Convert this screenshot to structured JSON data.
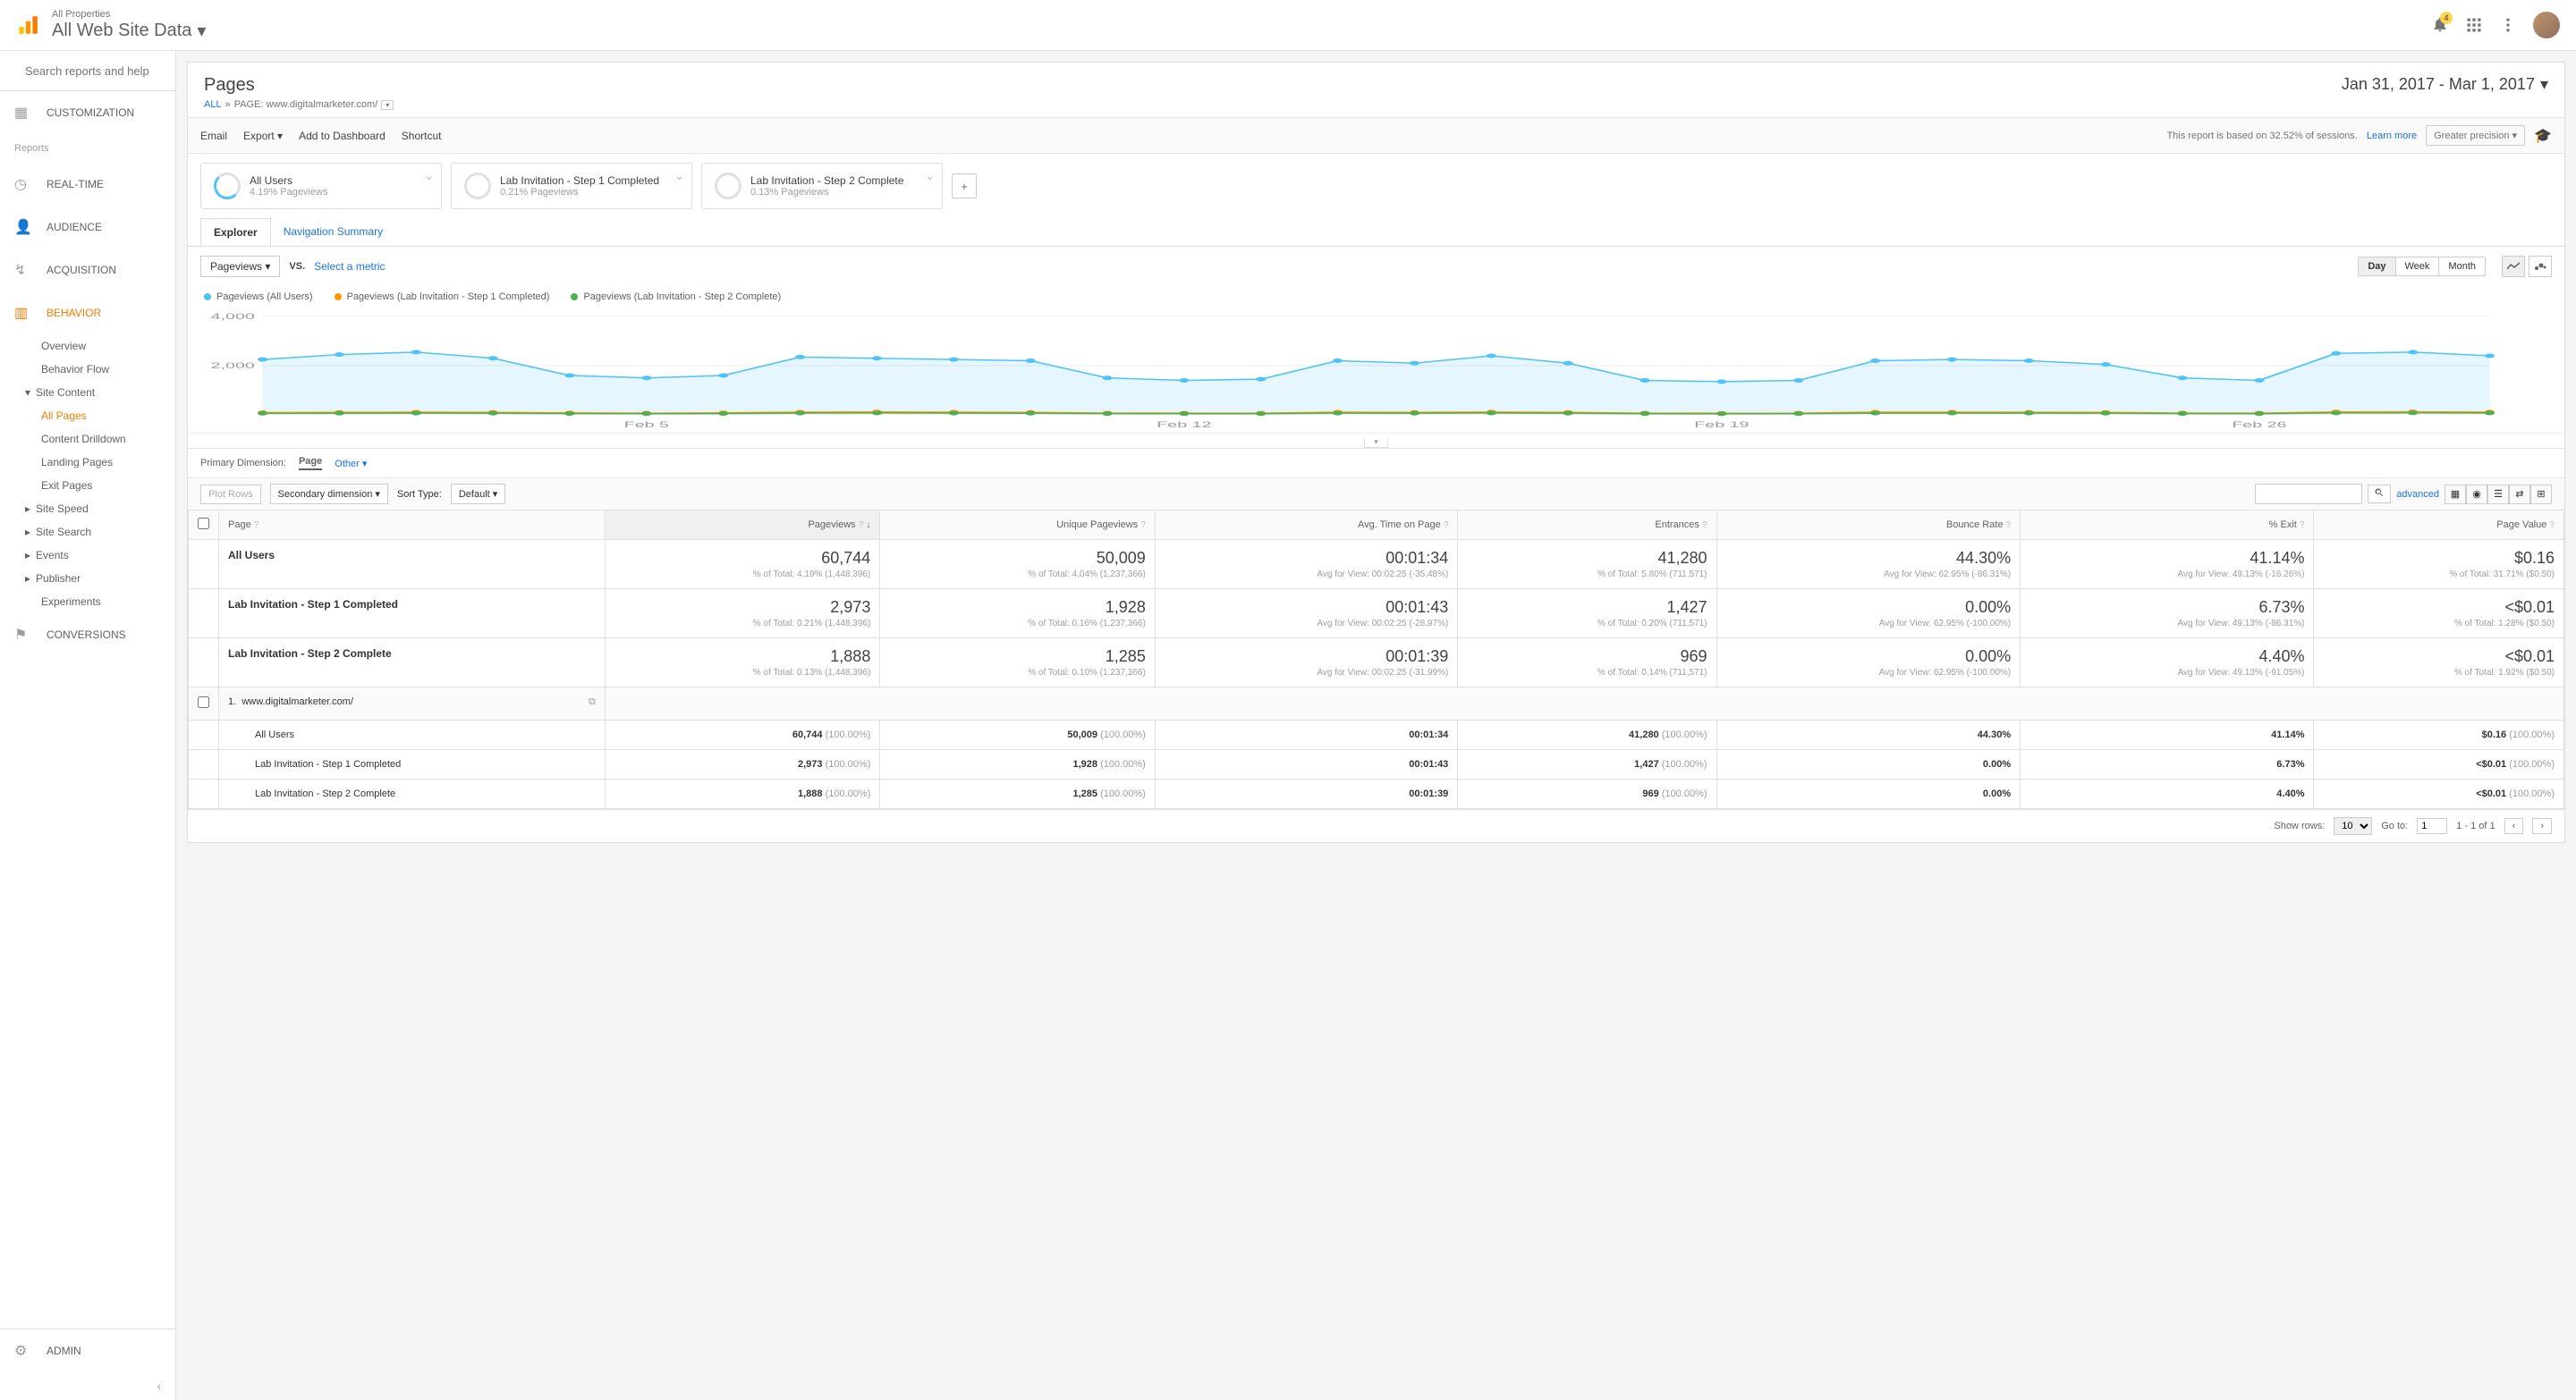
{
  "header": {
    "subtitle": "All Properties",
    "title": "All Web Site Data",
    "notif_count": "4"
  },
  "sidebar": {
    "search_placeholder": "Search reports and help",
    "customization": "CUSTOMIZATION",
    "reports_label": "Reports",
    "realtime": "REAL-TIME",
    "audience": "AUDIENCE",
    "acquisition": "ACQUISITION",
    "behavior": "BEHAVIOR",
    "behavior_sub": {
      "overview": "Overview",
      "flow": "Behavior Flow",
      "site_content": "Site Content",
      "all_pages": "All Pages",
      "drilldown": "Content Drilldown",
      "landing": "Landing Pages",
      "exit": "Exit Pages",
      "speed": "Site Speed",
      "search": "Site Search",
      "events": "Events",
      "publisher": "Publisher",
      "experiments": "Experiments"
    },
    "conversions": "CONVERSIONS",
    "admin": "ADMIN"
  },
  "report": {
    "title": "Pages",
    "breadcrumb_all": "ALL",
    "breadcrumb_page": "PAGE: www.digitalmarketer.com/",
    "date_range": "Jan 31, 2017 - Mar 1, 2017",
    "toolbar": {
      "email": "Email",
      "export": "Export",
      "dashboard": "Add to Dashboard",
      "shortcut": "Shortcut",
      "sample_text": "This report is based on 32.52% of sessions.",
      "learn_more": "Learn more",
      "precision": "Greater precision"
    },
    "segments": [
      {
        "name": "All Users",
        "sub": "4.19% Pageviews"
      },
      {
        "name": "Lab Invitation - Step 1 Completed",
        "sub": "0.21% Pageviews"
      },
      {
        "name": "Lab Invitation - Step 2 Complete",
        "sub": "0.13% Pageviews"
      }
    ],
    "tabs": {
      "explorer": "Explorer",
      "nav_summary": "Navigation Summary"
    },
    "chart_controls": {
      "metric": "Pageviews",
      "vs": "VS.",
      "select_metric": "Select a metric",
      "day": "Day",
      "week": "Week",
      "month": "Month"
    },
    "legend": [
      "Pageviews (All Users)",
      "Pageviews (Lab Invitation - Step 1 Completed)",
      "Pageviews (Lab Invitation - Step 2 Complete)"
    ],
    "dimension": {
      "label": "Primary Dimension:",
      "page": "Page",
      "other": "Other"
    },
    "table_ctrl": {
      "plot_rows": "Plot Rows",
      "secondary": "Secondary dimension",
      "sort_type": "Sort Type:",
      "default": "Default",
      "advanced": "advanced"
    },
    "columns": [
      "Page",
      "Pageviews",
      "Unique Pageviews",
      "Avg. Time on Page",
      "Entrances",
      "Bounce Rate",
      "% Exit",
      "Page Value"
    ],
    "summary": [
      {
        "label": "All Users",
        "cells": [
          {
            "v": "60,744",
            "s": "% of Total: 4.19% (1,448,396)"
          },
          {
            "v": "50,009",
            "s": "% of Total: 4.04% (1,237,366)"
          },
          {
            "v": "00:01:34",
            "s": "Avg for View: 00:02:25 (-35.48%)"
          },
          {
            "v": "41,280",
            "s": "% of Total: 5.80% (711,571)"
          },
          {
            "v": "44.30%",
            "s": "Avg for View: 62.95% (-86.31%)"
          },
          {
            "v": "41.14%",
            "s": "Avg for View: 49.13% (-16.26%)"
          },
          {
            "v": "$0.16",
            "s": "% of Total: 31.71% ($0.50)"
          }
        ]
      },
      {
        "label": "Lab Invitation - Step 1 Completed",
        "cells": [
          {
            "v": "2,973",
            "s": "% of Total: 0.21% (1,448,396)"
          },
          {
            "v": "1,928",
            "s": "% of Total: 0.16% (1,237,366)"
          },
          {
            "v": "00:01:43",
            "s": "Avg for View: 00:02:25 (-28.97%)"
          },
          {
            "v": "1,427",
            "s": "% of Total: 0.20% (711,571)"
          },
          {
            "v": "0.00%",
            "s": "Avg for View: 62.95% (-100.00%)"
          },
          {
            "v": "6.73%",
            "s": "Avg for View: 49.13% (-86.31%)"
          },
          {
            "v": "<$0.01",
            "s": "% of Total: 1.28% ($0.50)"
          }
        ]
      },
      {
        "label": "Lab Invitation - Step 2 Complete",
        "cells": [
          {
            "v": "1,888",
            "s": "% of Total: 0.13% (1,448,396)"
          },
          {
            "v": "1,285",
            "s": "% of Total: 0.10% (1,237,366)"
          },
          {
            "v": "00:01:39",
            "s": "Avg for View: 00:02:25 (-31.99%)"
          },
          {
            "v": "969",
            "s": "% of Total: 0.14% (711,571)"
          },
          {
            "v": "0.00%",
            "s": "Avg for View: 62.95% (-100.00%)"
          },
          {
            "v": "4.40%",
            "s": "Avg for View: 49.13% (-91.05%)"
          },
          {
            "v": "<$0.01",
            "s": "% of Total: 1.92% ($0.50)"
          }
        ]
      }
    ],
    "url_row": {
      "index": "1.",
      "url": "www.digitalmarketer.com/"
    },
    "detail": [
      {
        "label": "All Users",
        "vals": [
          "60,744",
          "50,009",
          "00:01:34",
          "41,280",
          "44.30%",
          "41.14%",
          "$0.16"
        ],
        "pcts": [
          "(100.00%)",
          "(100.00%)",
          "",
          "(100.00%)",
          "",
          "",
          "(100.00%)"
        ]
      },
      {
        "label": "Lab Invitation - Step 1 Completed",
        "vals": [
          "2,973",
          "1,928",
          "00:01:43",
          "1,427",
          "0.00%",
          "6.73%",
          "<$0.01"
        ],
        "pcts": [
          "(100.00%)",
          "(100.00%)",
          "",
          "(100.00%)",
          "",
          "",
          "(100.00%)"
        ]
      },
      {
        "label": "Lab Invitation - Step 2 Complete",
        "vals": [
          "1,888",
          "1,285",
          "00:01:39",
          "969",
          "0.00%",
          "4.40%",
          "<$0.01"
        ],
        "pcts": [
          "(100.00%)",
          "(100.00%)",
          "",
          "(100.00%)",
          "",
          "",
          "(100.00%)"
        ]
      }
    ],
    "pagination": {
      "show_rows": "Show rows:",
      "rows_value": "10",
      "goto": "Go to:",
      "goto_value": "1",
      "range": "1 - 1 of 1"
    }
  },
  "chart_data": {
    "type": "line",
    "x": [
      "Jan 31",
      "Feb 1",
      "Feb 2",
      "Feb 3",
      "Feb 4",
      "Feb 5",
      "Feb 6",
      "Feb 7",
      "Feb 8",
      "Feb 9",
      "Feb 10",
      "Feb 11",
      "Feb 12",
      "Feb 13",
      "Feb 14",
      "Feb 15",
      "Feb 16",
      "Feb 17",
      "Feb 18",
      "Feb 19",
      "Feb 20",
      "Feb 21",
      "Feb 22",
      "Feb 23",
      "Feb 24",
      "Feb 25",
      "Feb 26",
      "Feb 27",
      "Feb 28",
      "Mar 1"
    ],
    "x_ticks": [
      "Feb 5",
      "Feb 12",
      "Feb 19",
      "Feb 26"
    ],
    "series": [
      {
        "name": "Pageviews (All Users)",
        "color": "#4fc3f7",
        "values": [
          2250,
          2450,
          2550,
          2300,
          1600,
          1500,
          1600,
          2350,
          2300,
          2250,
          2200,
          1500,
          1400,
          1450,
          2200,
          2100,
          2400,
          2100,
          1400,
          1350,
          1400,
          2200,
          2250,
          2200,
          2050,
          1500,
          1400,
          2500,
          2550,
          2400
        ]
      },
      {
        "name": "Pageviews (Lab Invitation - Step 1 Completed)",
        "color": "#ff9800",
        "values": [
          90,
          100,
          110,
          100,
          80,
          70,
          80,
          110,
          120,
          110,
          100,
          75,
          70,
          70,
          110,
          100,
          115,
          100,
          70,
          65,
          70,
          110,
          110,
          105,
          100,
          75,
          70,
          120,
          125,
          115
        ]
      },
      {
        "name": "Pageviews (Lab Invitation - Step 2 Complete)",
        "color": "#4caf50",
        "values": [
          60,
          65,
          70,
          65,
          50,
          45,
          50,
          70,
          75,
          70,
          65,
          48,
          45,
          45,
          70,
          65,
          72,
          65,
          45,
          42,
          45,
          70,
          70,
          68,
          65,
          48,
          45,
          75,
          80,
          72
        ]
      }
    ],
    "ylim": [
      0,
      4000
    ],
    "y_ticks": [
      2000,
      4000
    ]
  }
}
